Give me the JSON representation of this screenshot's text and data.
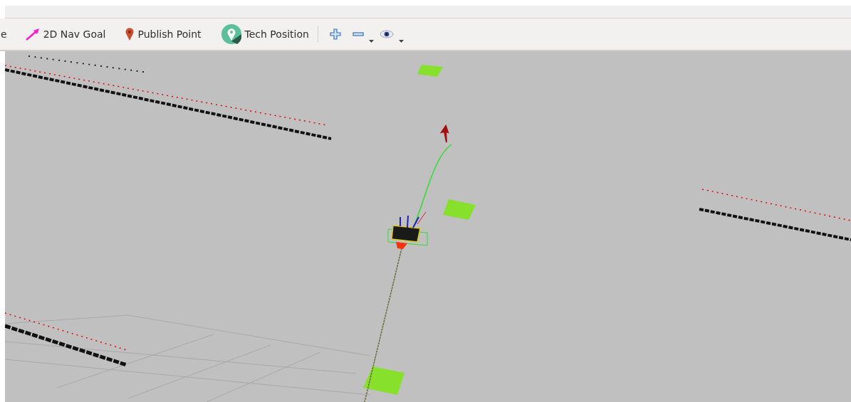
{
  "toolbar": {
    "tools": [
      {
        "kind": "cut",
        "label": "e"
      },
      {
        "kind": "nav-goal",
        "label": "2D Nav Goal"
      },
      {
        "kind": "publish-point",
        "label": "Publish Point"
      },
      {
        "kind": "tech-position",
        "label": "Tech Position"
      },
      {
        "kind": "zoom-in"
      },
      {
        "kind": "zoom-out"
      },
      {
        "kind": "view"
      }
    ]
  }
}
